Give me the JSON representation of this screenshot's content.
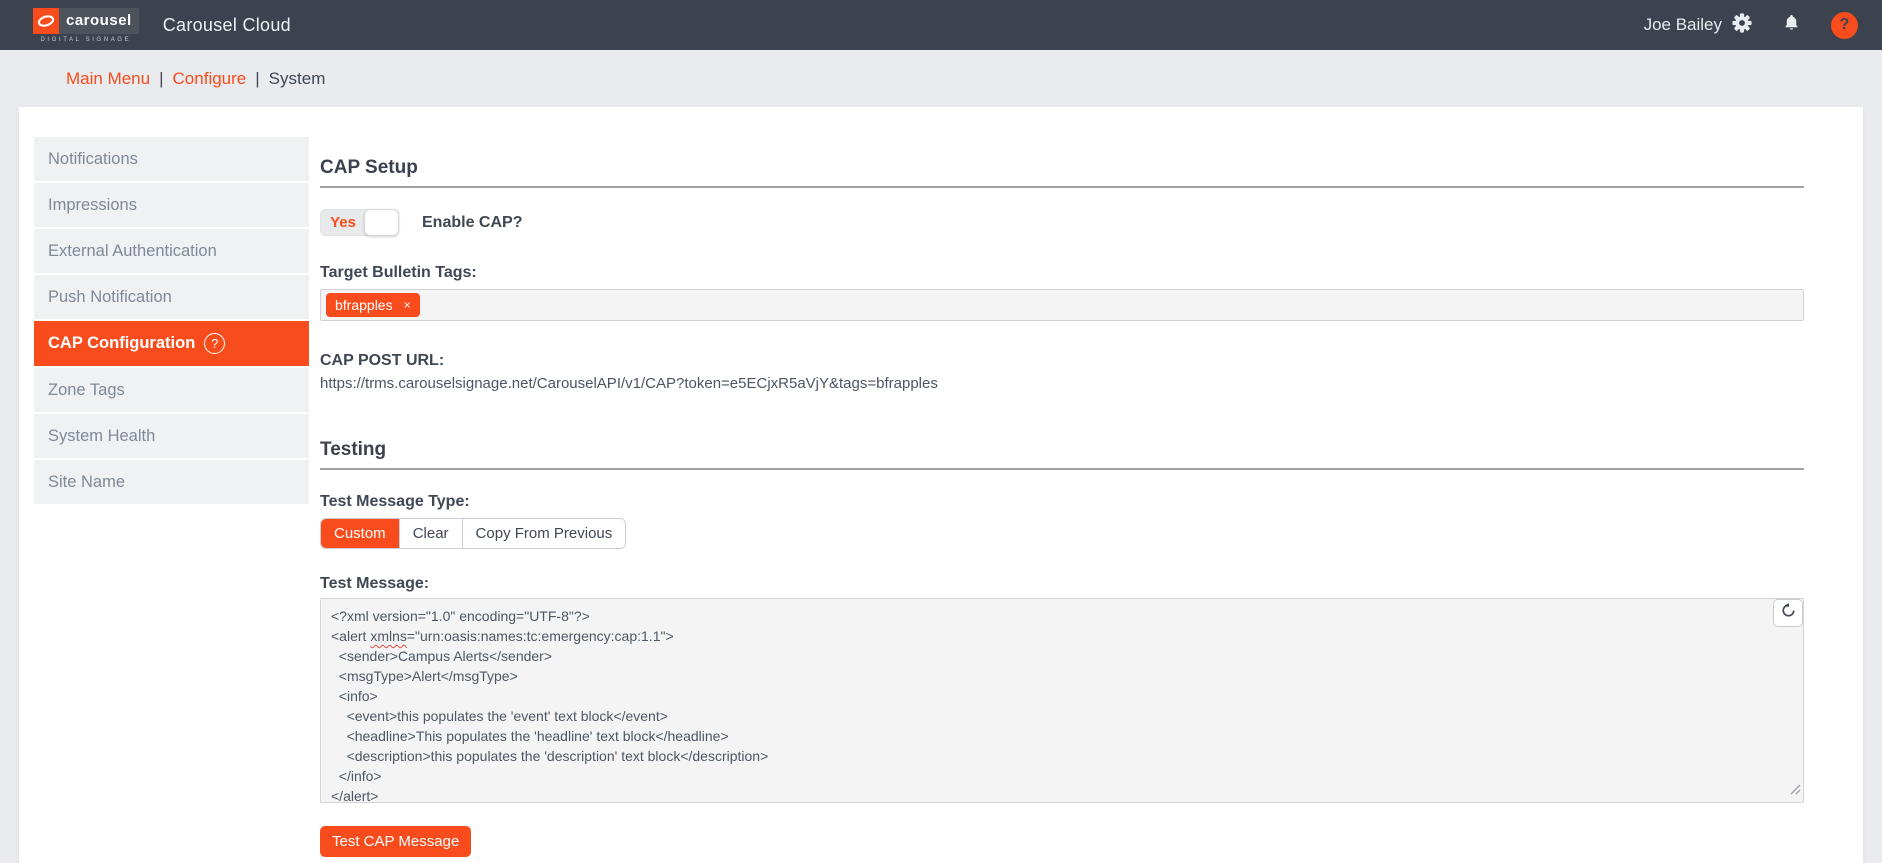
{
  "colors": {
    "accent": "#f84c1c",
    "header_bg": "#3c434f",
    "page_bg": "#e9ebee"
  },
  "header": {
    "logo_word": "carousel",
    "logo_tagline": "DIGITAL SIGNAGE",
    "app_title": "Carousel Cloud",
    "user_name": "Joe Bailey",
    "help_glyph": "?"
  },
  "breadcrumb": {
    "separator": "|",
    "items": [
      {
        "label": "Main Menu"
      },
      {
        "label": "Configure"
      },
      {
        "label": "System"
      }
    ]
  },
  "sidebar": {
    "items": [
      {
        "label": "Notifications"
      },
      {
        "label": "Impressions"
      },
      {
        "label": "External Authentication"
      },
      {
        "label": "Push Notification"
      },
      {
        "label": "CAP Configuration",
        "selected": true,
        "help_glyph": "?"
      },
      {
        "label": "Zone Tags"
      },
      {
        "label": "System Health"
      },
      {
        "label": "Site Name"
      }
    ]
  },
  "cap_setup": {
    "title": "CAP Setup",
    "toggle_value": "Yes",
    "enable_label": "Enable CAP?",
    "tags_label": "Target Bulletin Tags:",
    "tags": [
      "bfrapples"
    ],
    "tag_remove_glyph": "×",
    "post_url_label": "CAP POST URL:",
    "post_url": "https://trms.carouselsignage.net/CarouselAPI/v1/CAP?token=e5ECjxR5aVjY&tags=bfrapples"
  },
  "testing": {
    "title": "Testing",
    "type_label": "Test Message Type:",
    "type_options": [
      "Custom",
      "Clear",
      "Copy From Previous"
    ],
    "selected_type": "Custom",
    "message_label": "Test Message:",
    "message": "<?xml version=\"1.0\" encoding=\"UTF-8\"?>\n<alert xmlns=\"urn:oasis:names:tc:emergency:cap:1.1\">\n  <sender>Campus Alerts</sender>\n  <msgType>Alert</msgType>\n  <info>\n    <event>this populates the 'event' text block</event>\n    <headline>This populates the 'headline' text block</headline>\n    <description>this populates the 'description' text block</description>\n  </info>\n</alert>",
    "misspelled_word": "xmlns",
    "submit_label": "Test CAP Message"
  }
}
